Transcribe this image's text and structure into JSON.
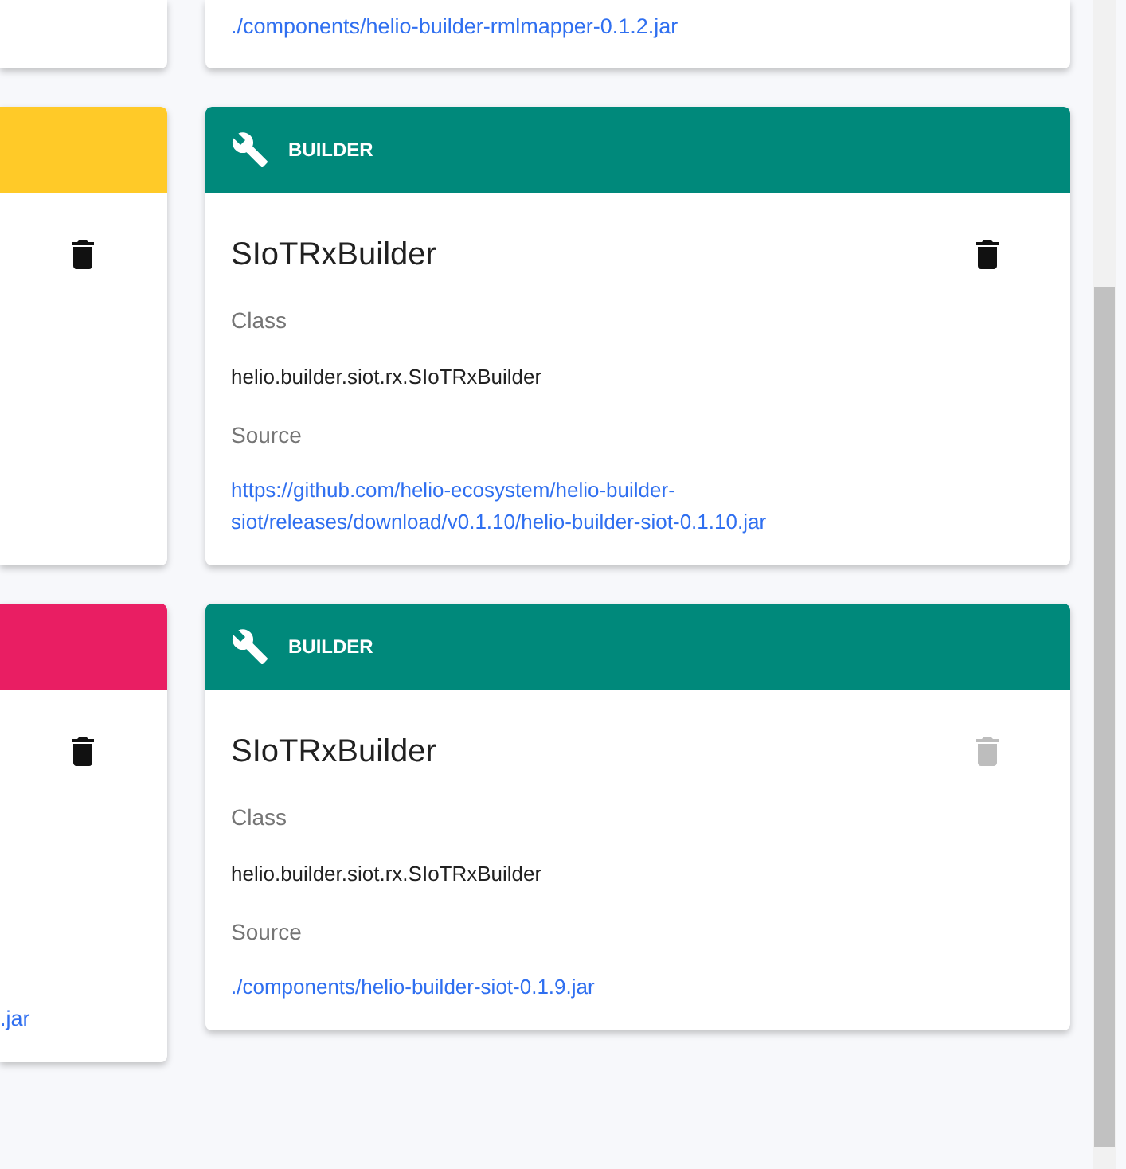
{
  "left_column": [
    {
      "kind": "tail"
    },
    {
      "kind": "full",
      "color": "#ffca28",
      "disabled": false
    },
    {
      "kind": "full",
      "color": "#e91e63",
      "disabled": false,
      "source": ".jar"
    }
  ],
  "right_column": [
    {
      "kind": "tail",
      "source": "./components/helio-builder-rmlmapper-0.1.2.jar"
    },
    {
      "kind": "full",
      "type": "BUILDER",
      "color": "#00897b",
      "name": "SIoTRxBuilder",
      "class_label": "Class",
      "class": "helio.builder.siot.rx.SIoTRxBuilder",
      "source_label": "Source",
      "source": "https://github.com/helio-ecosystem/helio-builder-siot/releases/download/v0.1.10/helio-builder-siot-0.1.10.jar",
      "disabled": false
    },
    {
      "kind": "full",
      "type": "BUILDER",
      "color": "#00897b",
      "name": "SIoTRxBuilder",
      "class_label": "Class",
      "class": "helio.builder.siot.rx.SIoTRxBuilder",
      "source_label": "Source",
      "source": "./components/helio-builder-siot-0.1.9.jar",
      "disabled": true
    }
  ]
}
